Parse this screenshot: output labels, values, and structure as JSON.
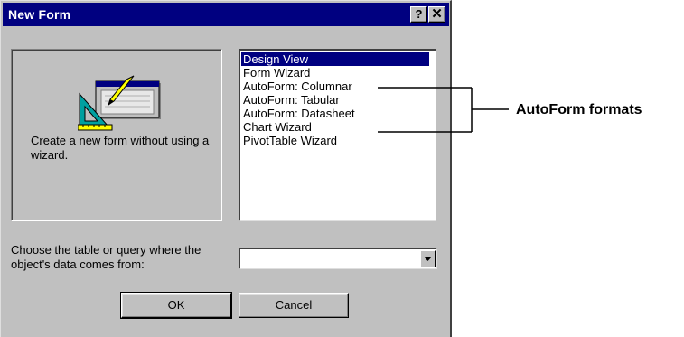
{
  "window": {
    "title": "New Form",
    "help_glyph": "?",
    "close_glyph": "✕"
  },
  "preview": {
    "icon": "design-view-form-icon",
    "description": "Create a new form without using a wizard."
  },
  "options": [
    {
      "label": "Design View",
      "selected": true
    },
    {
      "label": "Form Wizard",
      "selected": false
    },
    {
      "label": "AutoForm:  Columnar",
      "selected": false
    },
    {
      "label": "AutoForm:  Tabular",
      "selected": false
    },
    {
      "label": "AutoForm:  Datasheet",
      "selected": false
    },
    {
      "label": "Chart Wizard",
      "selected": false
    },
    {
      "label": "PivotTable Wizard",
      "selected": false
    }
  ],
  "source": {
    "label": "Choose the table or query where the object's data comes from:",
    "value": ""
  },
  "buttons": {
    "ok": "OK",
    "cancel": "Cancel"
  },
  "annotation": {
    "label": "AutoForm formats"
  },
  "colors": {
    "titlebar": "#000080",
    "face": "#c0c0c0",
    "selection": "#000080"
  }
}
